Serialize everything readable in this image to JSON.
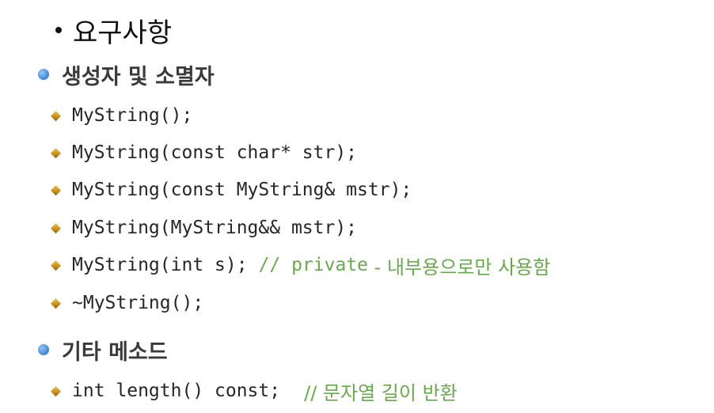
{
  "title": {
    "bullet": "•",
    "text": "요구사항"
  },
  "sections": [
    {
      "label": "생성자 및 소멸자",
      "items": [
        {
          "code": "MyString();"
        },
        {
          "code": "MyString(const char* str);"
        },
        {
          "code": "MyString(const MyString& mstr);"
        },
        {
          "code": "MyString(MyString&& mstr);"
        },
        {
          "code": "MyString(int s);",
          "comment_prefix": "// private",
          "comment_suffix": " - 내부용으로만 사용함"
        },
        {
          "code": "~MyString();"
        }
      ]
    },
    {
      "label": "기타 메소드",
      "items": [
        {
          "code": "int length() const;",
          "comment": "// 문자열 길이 반환"
        }
      ]
    }
  ],
  "colors": {
    "section_bullet": "#4e92dc",
    "item_bullet": "#c8901a",
    "comment": "#6aa84f"
  }
}
